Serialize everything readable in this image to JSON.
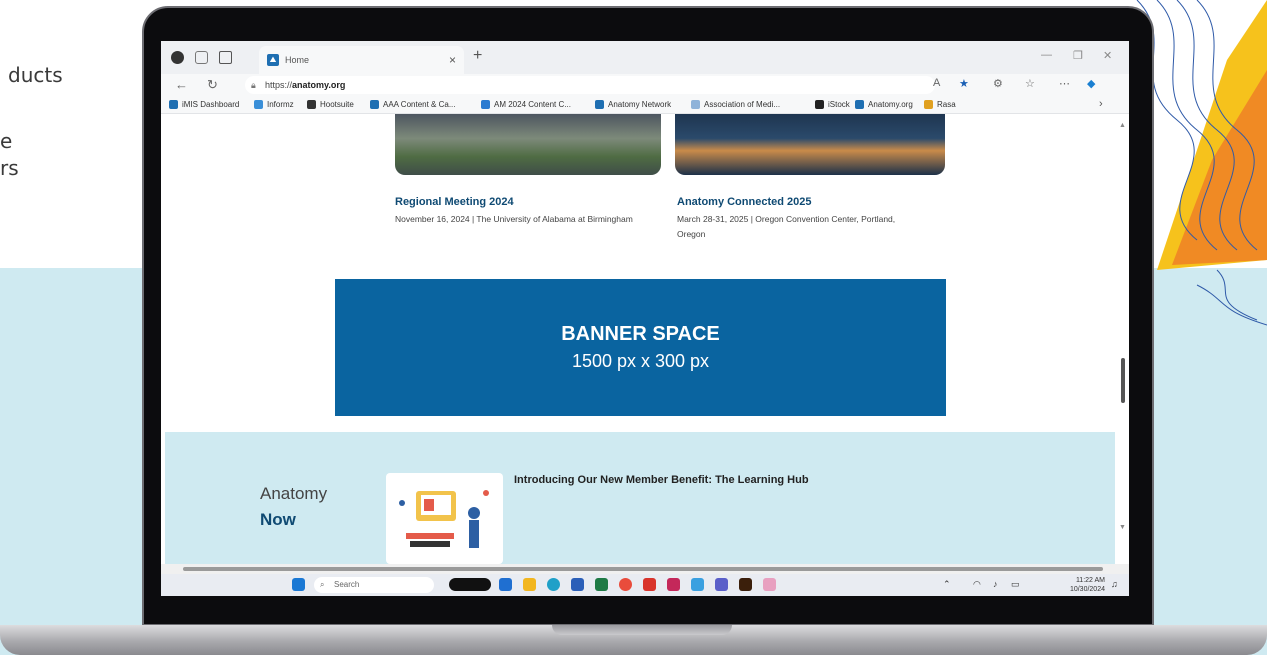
{
  "side_text": {
    "line1": "ducts",
    "line2": "e",
    "line3": "rs"
  },
  "browser": {
    "tab_title": "Home",
    "url_prefix": "https://",
    "url_domain": "anatomy.org",
    "bookmarks": [
      {
        "label": "iMIS Dashboard",
        "color": "#1f6fb2"
      },
      {
        "label": "Informz",
        "color": "#3a8fd8"
      },
      {
        "label": "Hootsuite",
        "color": "#333333"
      },
      {
        "label": "AAA Content & Ca...",
        "color": "#1f6fb2"
      },
      {
        "label": "AM 2024 Content C...",
        "color": "#2b7bd1"
      },
      {
        "label": "Anatomy Network",
        "color": "#1f6fb2"
      },
      {
        "label": "Association of Medi...",
        "color": "#8fb3d9"
      },
      {
        "label": "iStock",
        "color": "#222222"
      },
      {
        "label": "Anatomy.org",
        "color": "#1f6fb2"
      },
      {
        "label": "Rasa",
        "color": "#e0a020"
      }
    ]
  },
  "events": [
    {
      "title": "Regional Meeting 2024",
      "desc": "November 16, 2024 | The University of Alabama at Birmingham"
    },
    {
      "title": "Anatomy Connected 2025",
      "desc": "March 28-31, 2025 | Oregon Convention Center, Portland, Oregon"
    }
  ],
  "banner": {
    "title": "BANNER SPACE",
    "size": "1500 px x 300 px"
  },
  "news": {
    "brand_line1": "Anatomy",
    "brand_line2": "Now",
    "headline": "Introducing Our New Member Benefit: The Learning Hub"
  },
  "taskbar": {
    "search_placeholder": "Search",
    "time": "11:22 AM",
    "date": "10/30/2024"
  }
}
